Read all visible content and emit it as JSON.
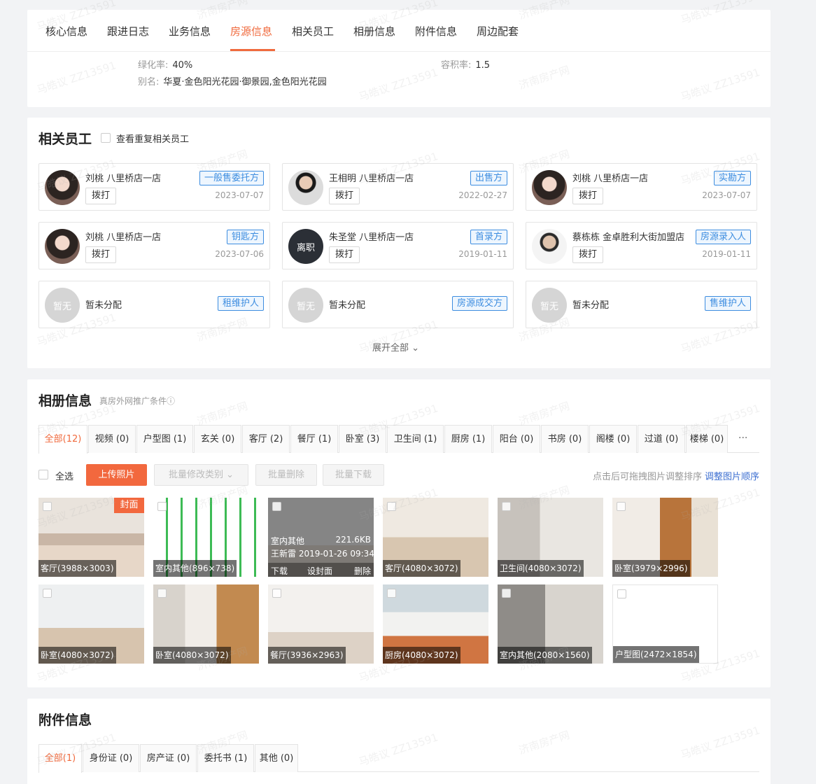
{
  "nav": {
    "tabs": [
      "核心信息",
      "跟进日志",
      "业务信息",
      "房源信息",
      "相关员工",
      "相册信息",
      "附件信息",
      "周边配套"
    ],
    "active": "房源信息"
  },
  "property": {
    "green_label": "绿化率:",
    "green_value": "40%",
    "far_label": "容积率:",
    "far_value": "1.5",
    "alias_label": "别名:",
    "alias_value": "华夏·金色阳光花园·御景园,金色阳光花园"
  },
  "staff": {
    "title": "相关员工",
    "dup_label": "查看重复相关员工",
    "call_label": "拨打",
    "left_label": "离职",
    "none_avatar": "暂无",
    "none_name": "暂未分配",
    "expand": "展开全部",
    "items": [
      {
        "name": "刘桃 八里桥店一店",
        "role": "一般售委托方",
        "date": "2023-07-07",
        "avatar": "woman"
      },
      {
        "name": "王相明 八里桥店一店",
        "role": "出售方",
        "date": "2022-02-27",
        "avatar": "man"
      },
      {
        "name": "刘桃 八里桥店一店",
        "role": "实勘方",
        "date": "2023-07-07",
        "avatar": "woman"
      },
      {
        "name": "刘桃 八里桥店一店",
        "role": "钥匙方",
        "date": "2023-07-06",
        "avatar": "woman"
      },
      {
        "name": "朱圣堂 八里桥店一店",
        "role": "首录方",
        "date": "2019-01-11",
        "avatar": "left"
      },
      {
        "name": "蔡栋栋 金卓胜利大街加盟店",
        "role": "房源录入人",
        "date": "2019-01-11",
        "avatar": "man2"
      },
      {
        "name": "",
        "role": "租维护人",
        "date": "",
        "avatar": "none"
      },
      {
        "name": "",
        "role": "房源成交方",
        "date": "",
        "avatar": "none"
      },
      {
        "name": "",
        "role": "售维护人",
        "date": "",
        "avatar": "none"
      }
    ]
  },
  "album": {
    "title": "相册信息",
    "subtitle": "真房外网推广条件ⓘ",
    "tabs": [
      "全部(12)",
      "视频 (0)",
      "户型图 (1)",
      "玄关 (0)",
      "客厅 (2)",
      "餐厅 (1)",
      "卧室 (3)",
      "卫生间 (1)",
      "厨房 (1)",
      "阳台 (0)",
      "书房 (0)",
      "阁楼 (0)",
      "过道 (0)",
      "楼梯 (0)"
    ],
    "more": "···",
    "select_all": "全选",
    "upload": "上传照片",
    "batch_type": "批量修改类别",
    "batch_delete": "批量删除",
    "batch_download": "批量下载",
    "sort_hint": "点击后可拖拽图片调整排序",
    "sort_link": "调整图片顺序",
    "cover_label": "封面",
    "hover": {
      "category": "室内其他",
      "size": "221.6KB",
      "uploader": "王新雷 2019-01-26 09:34",
      "download": "下载",
      "set_cover": "设封面",
      "delete": "删除"
    },
    "photos": [
      {
        "label": "客厅(3988×3003)",
        "kind": "living"
      },
      {
        "label": "室内其他(896×738)",
        "kind": "plan-green"
      },
      {
        "label": "",
        "kind": "hover"
      },
      {
        "label": "客厅(4080×3072)",
        "kind": "living2"
      },
      {
        "label": "卫生间(4080×3072)",
        "kind": "bath"
      },
      {
        "label": "卧室(3979×2996)",
        "kind": "bed-wood"
      },
      {
        "label": "卧室(4080×3072)",
        "kind": "bed"
      },
      {
        "label": "卧室(4080×3072)",
        "kind": "bed2"
      },
      {
        "label": "餐厅(3936×2963)",
        "kind": "dining"
      },
      {
        "label": "厨房(4080×3072)",
        "kind": "kitchen"
      },
      {
        "label": "室内其他(2080×1560)",
        "kind": "people"
      },
      {
        "label": "户型图(2472×1854)",
        "kind": "plan"
      }
    ]
  },
  "attach": {
    "title": "附件信息",
    "tabs": [
      "全部(1)",
      "身份证 (0)",
      "房产证 (0)",
      "委托书 (1)",
      "其他 (0)"
    ]
  },
  "watermark": [
    "马皓议 ZZ13591",
    "济南房产网"
  ],
  "colors": {
    "accent": "#f06a3d",
    "link": "#3d6fd1",
    "tag": "#3d8de0"
  }
}
